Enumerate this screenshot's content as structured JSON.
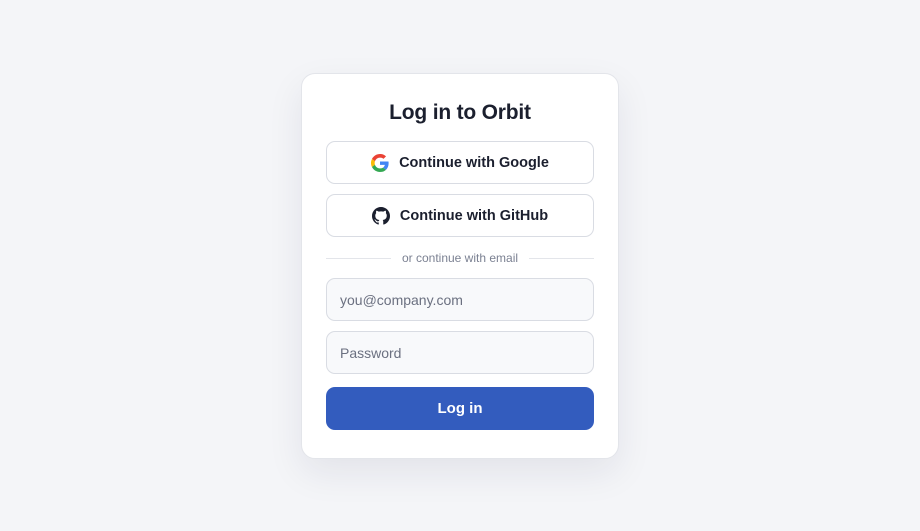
{
  "login": {
    "title": "Log in to Orbit",
    "google_label": "Continue with Google",
    "github_label": "Continue with GitHub",
    "divider_text": "or continue with email",
    "email_placeholder": "you@company.com",
    "email_value": "",
    "password_placeholder": "Password",
    "password_value": "",
    "submit_label": "Log in"
  },
  "icons": {
    "google": "google-logo-icon",
    "github": "github-logo-icon"
  },
  "colors": {
    "background": "#f4f5f8",
    "card": "#ffffff",
    "primary_button": "#335cbe",
    "title_text": "#1b1f2e",
    "muted_text": "#7b8192"
  }
}
